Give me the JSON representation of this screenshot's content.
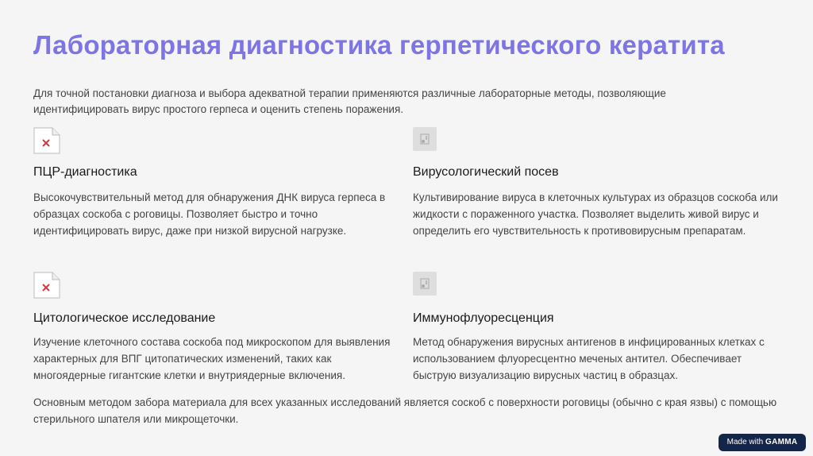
{
  "title": "Лабораторная диагностика герпетического кератита",
  "intro": "Для точной постановки диагноза и выбора адекватной терапии применяются различные лабораторные методы, позволяющие идентифицировать вирус простого герпеса и оценить степень поражения.",
  "cards": [
    {
      "icon": "broken-image-icon",
      "heading": "ПЦР-диагностика",
      "text": "Высокочувствительный метод для обнаружения ДНК вируса герпеса в образцах соскоба с роговицы. Позволяет быстро и точно идентифицировать вирус, даже при низкой вирусной нагрузке."
    },
    {
      "icon": "image-placeholder-icon",
      "heading": "Вирусологический посев",
      "text": "Культивирование вируса в клеточных культурах из образцов соскоба или жидкости с пораженного участка. Позволяет выделить живой вирус и определить его чувствительность к противовирусным препаратам."
    },
    {
      "icon": "broken-image-icon",
      "heading": "Цитологическое исследование",
      "text": "Изучение клеточного состава соскоба под микроскопом для выявления характерных для ВПГ цитопатических изменений, таких как многоядерные гигантские клетки и внутриядерные включения."
    },
    {
      "icon": "image-placeholder-icon",
      "heading": "Иммунофлуоресценция",
      "text": "Метод обнаружения вирусных антигенов в инфицированных клетках с использованием флуоресцентно меченых антител. Обеспечивает быструю визуализацию вирусных частиц в образцах."
    }
  ],
  "footer_note": "Основным методом забора материала для всех указанных исследований является соскоб с поверхности роговицы (обычно с края язвы) с помощью стерильного шпателя или микрощеточки.",
  "badge": {
    "prefix": "Made with",
    "brand": "GAMMA"
  },
  "colors": {
    "title": "#7d74e6",
    "badge_bg": "#14254a",
    "background": "#f5f5f6"
  }
}
